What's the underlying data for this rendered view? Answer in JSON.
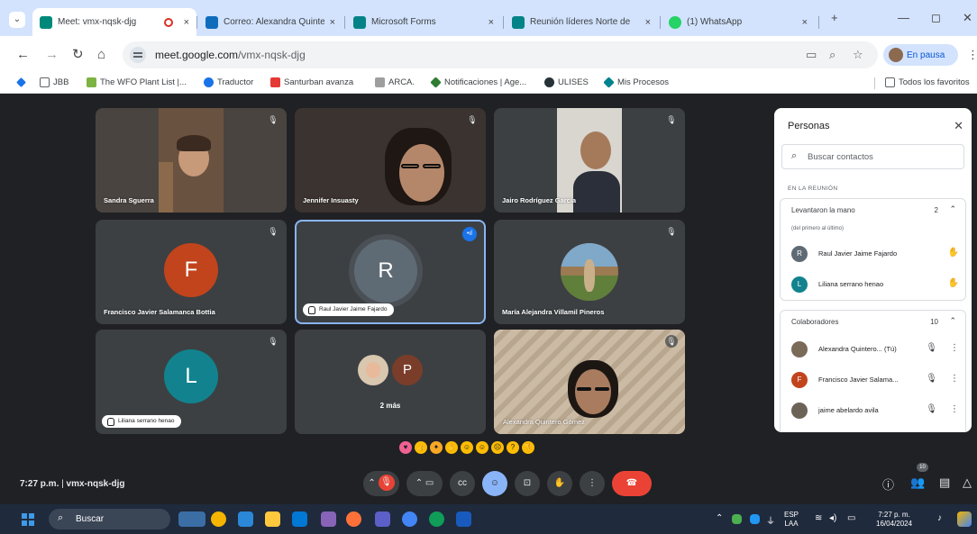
{
  "browser": {
    "tabs": [
      {
        "title": "Meet: vmx-nqsk-djg",
        "active": true,
        "favicon_color": "#00897b"
      },
      {
        "title": "Correo: Alexandra Quinte",
        "favicon_color": "#0f6cbd"
      },
      {
        "title": "Microsoft Forms",
        "favicon_color": "#038387"
      },
      {
        "title": "Reunión líderes Norte de",
        "favicon_color": "#038387"
      },
      {
        "title": "(1) WhatsApp",
        "favicon_color": "#25d366"
      }
    ],
    "tab_close_glyph": "×",
    "new_tab_glyph": "+",
    "url_host": "meet.google.com",
    "url_path": "/vmx-nqsk-djg",
    "profile_label": "En pausa",
    "bookmarks": [
      {
        "label": "JBB",
        "color": "#5f6368"
      },
      {
        "label": "The WFO Plant List |...",
        "color": "#7cb342"
      },
      {
        "label": "Traductor",
        "color": "#1a73e8"
      },
      {
        "label": "Santurban avanza",
        "color": "#e53935"
      },
      {
        "label": "ARCA.",
        "color": "#9e9e9e"
      },
      {
        "label": "Notificaciones | Age...",
        "color": "#2e7d32"
      },
      {
        "label": "ULISES",
        "color": "#263238"
      },
      {
        "label": "Mis Procesos",
        "color": "#00838f"
      }
    ],
    "all_bookmarks": "Todos los favoritos"
  },
  "meet": {
    "tiles": [
      {
        "name": "Sandra Sguerra",
        "type": "camera"
      },
      {
        "name": "Jennifer Insuasty",
        "type": "camera"
      },
      {
        "name": "Jairo Rodríguez García",
        "type": "camera"
      },
      {
        "name": "Francisco Javier Salamanca Bottia",
        "type": "avatar",
        "initial": "F",
        "color": "#c1441c"
      },
      {
        "name": "Raul Javier Jaime Fajardo",
        "type": "avatar",
        "initial": "R",
        "color": "#5f6b74",
        "speaking": true
      },
      {
        "name": "María Alejandra Villamil Pineros",
        "type": "camera"
      },
      {
        "name": "Liliana serrano henao",
        "type": "avatar",
        "initial": "L",
        "color": "#12838e"
      },
      {
        "name": "2 más",
        "type": "group",
        "initial": "P"
      },
      {
        "name": "Alexandra Quintero Gómez",
        "type": "camera"
      }
    ],
    "meeting_time": "7:27 p.m.",
    "meeting_code": "vmx-nqsk-djg",
    "participant_badge": "10"
  },
  "people_panel": {
    "title": "Personas",
    "search_placeholder": "Buscar contactos",
    "in_meeting_label": "EN LA REUNIÓN",
    "raised_hands": {
      "label": "Levantaron la mano",
      "count": "2",
      "subtitle": "(del primero al último)",
      "people": [
        {
          "name": "Raul Javier Jaime Fajardo",
          "initial": "R",
          "color": "#5f6b74"
        },
        {
          "name": "Liliana serrano henao",
          "initial": "L",
          "color": "#12838e"
        }
      ]
    },
    "collaborators": {
      "label": "Colaboradores",
      "count": "10",
      "people": [
        {
          "name": "Alexandra Quintero... (Tú)",
          "initial": "",
          "color": "#7a6a58"
        },
        {
          "name": "Francisco Javier Salama...",
          "initial": "F",
          "color": "#c1441c"
        },
        {
          "name": "jaime abelardo avila",
          "initial": "",
          "color": "#6d6258"
        }
      ]
    }
  },
  "taskbar": {
    "search_label": "Buscar",
    "language": "ESP",
    "language_sub": "LAA",
    "clock_time": "7:27 p. m.",
    "clock_date": "16/04/2024"
  }
}
